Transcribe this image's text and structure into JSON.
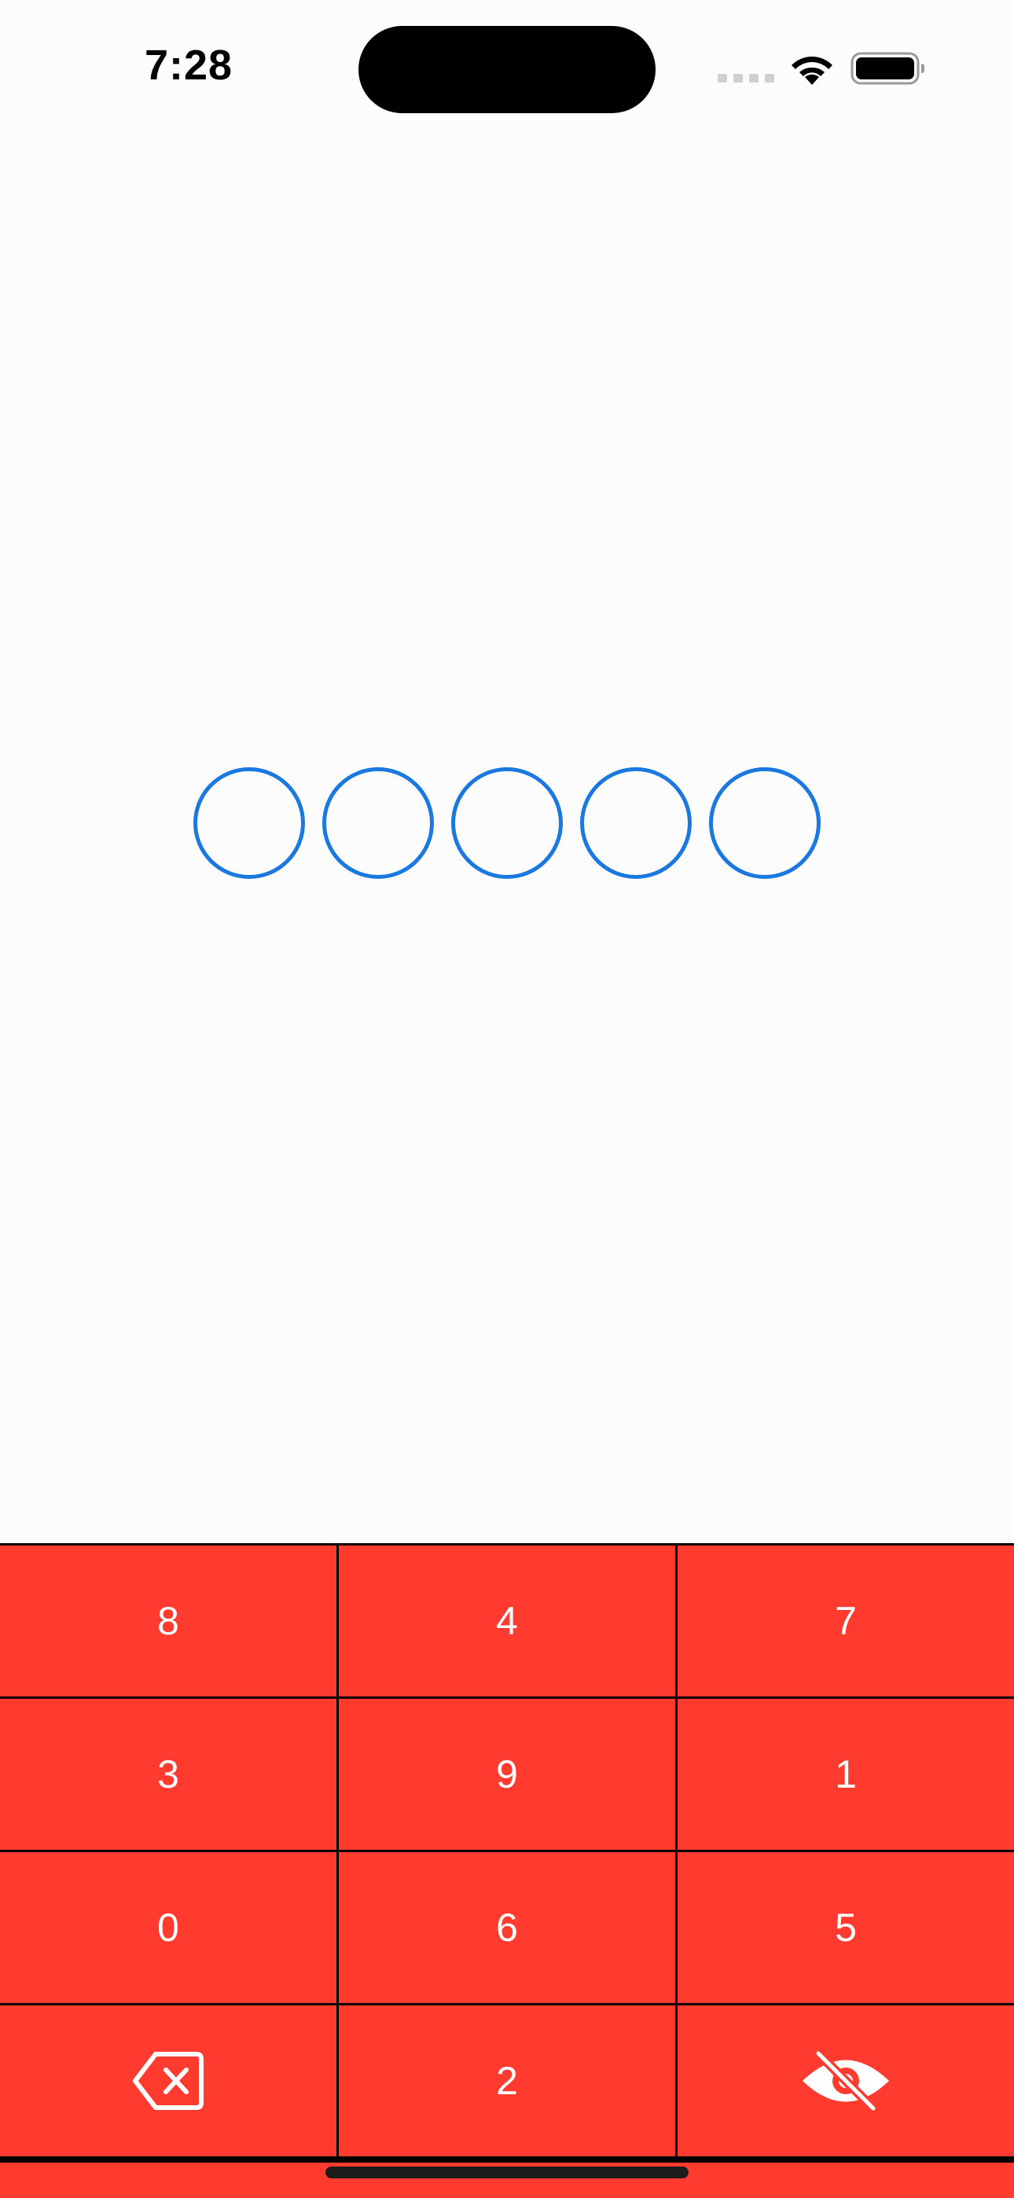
{
  "status_bar": {
    "time": "7:28"
  },
  "pin": {
    "length": 5,
    "filled": 0,
    "color": "#1a78e0"
  },
  "keypad": {
    "color": "#ff3b30",
    "keys": [
      {
        "label": "8"
      },
      {
        "label": "4"
      },
      {
        "label": "7"
      },
      {
        "label": "3"
      },
      {
        "label": "9"
      },
      {
        "label": "1"
      },
      {
        "label": "0"
      },
      {
        "label": "6"
      },
      {
        "label": "5"
      },
      {
        "icon": "backspace-icon"
      },
      {
        "label": "2"
      },
      {
        "icon": "eye-slash-icon"
      }
    ]
  }
}
